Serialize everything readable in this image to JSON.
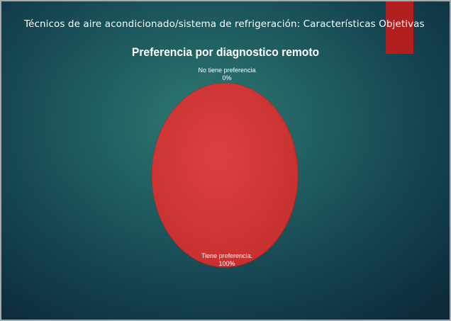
{
  "slide": {
    "title": "Técnicos de aire acondicionado/sistema de refrigeración: Características Objetivas",
    "accent_color": "#b21f1f"
  },
  "chart_data": {
    "type": "pie",
    "title": "Preferencia por diagnostico remoto",
    "slices": [
      {
        "label": "No tiene preferencia",
        "percent_label": "0%",
        "value": 0,
        "color": "#d63a3a"
      },
      {
        "label": "Tiene preferencia.",
        "percent_label": "100%",
        "value": 100,
        "color": "#d63a3a"
      }
    ]
  }
}
